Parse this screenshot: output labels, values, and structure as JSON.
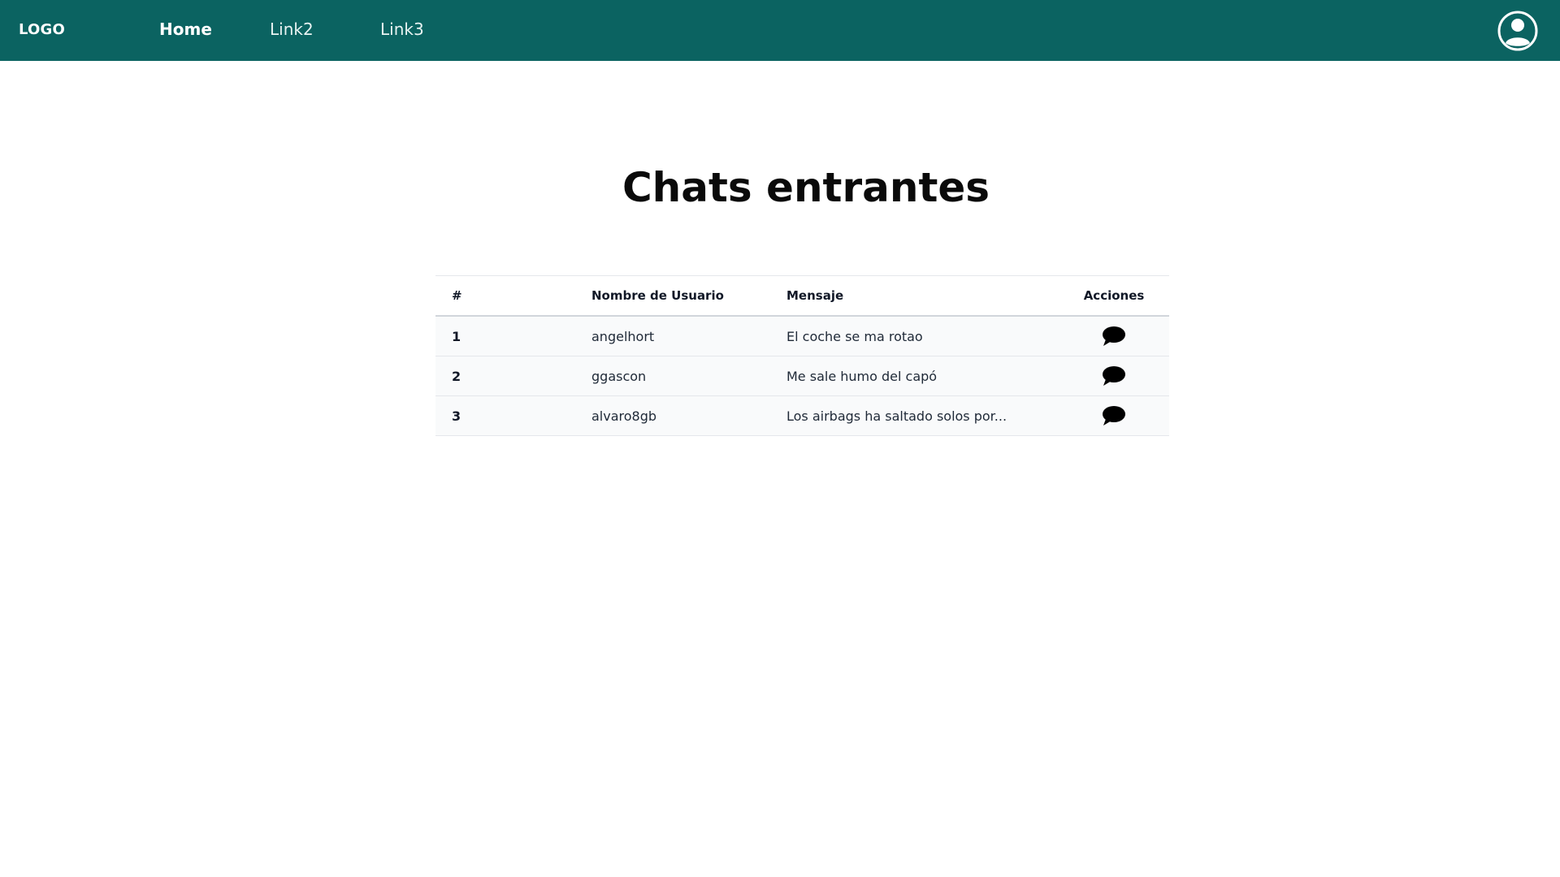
{
  "navbar": {
    "logo": "LOGO",
    "links": [
      {
        "label": "Home"
      },
      {
        "label": "Link2"
      },
      {
        "label": "Link3"
      }
    ],
    "background": "#0b6361"
  },
  "page": {
    "title": "Chats entrantes"
  },
  "table": {
    "headers": [
      "#",
      "Nombre de Usuario",
      "Mensaje",
      "Acciones"
    ],
    "rows": [
      {
        "num": "1",
        "user": "angelhort",
        "message": "El coche se ma rotao",
        "action_icon": "chat-bubble-icon"
      },
      {
        "num": "2",
        "user": "ggascon",
        "message": "Me sale humo del capó",
        "action_icon": "chat-bubble-icon"
      },
      {
        "num": "3",
        "user": "alvaro8gb",
        "message": "Los airbags ha saltado solos por...",
        "action_icon": "chat-bubble-icon"
      }
    ]
  },
  "icons": {
    "avatar": "user-circle-icon"
  }
}
